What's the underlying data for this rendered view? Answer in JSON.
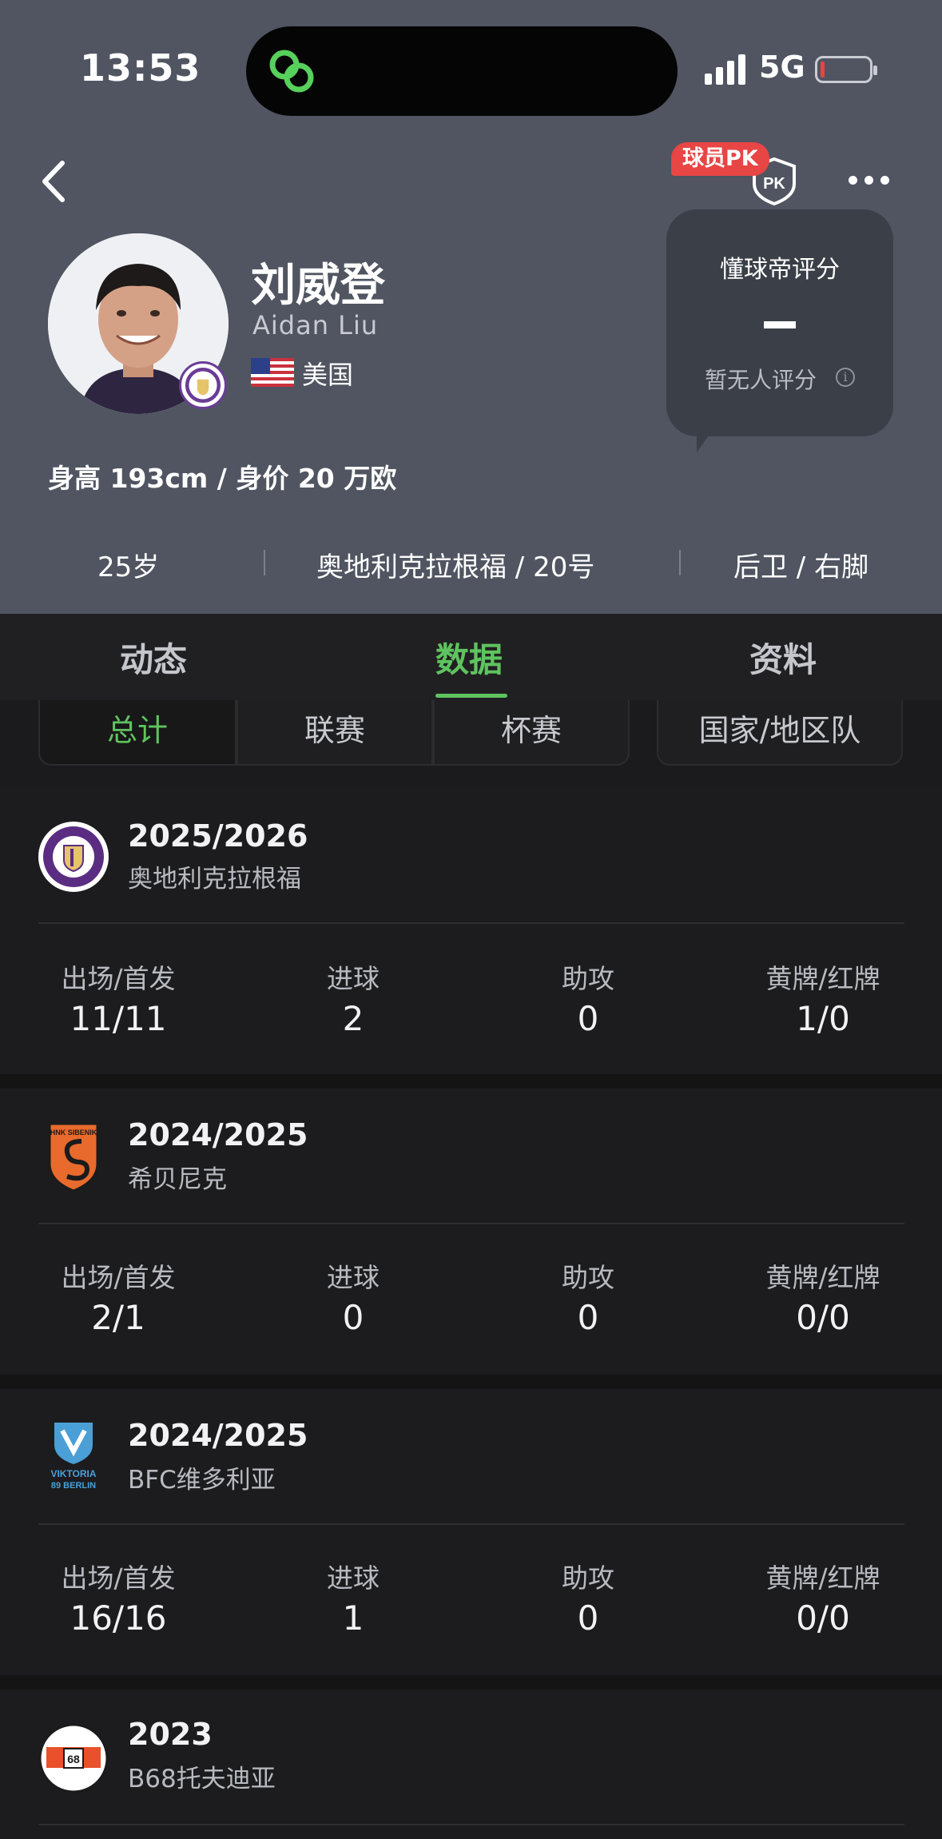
{
  "status_bar": {
    "time": "13:53",
    "network": "5G"
  },
  "nav": {
    "pk_label": "球员PK",
    "pk_shield_text": "PK"
  },
  "player": {
    "name_cn": "刘威登",
    "name_en": "Aidan Liu",
    "nation": "美国",
    "height_value": "身高 193cm / 身价 20 万欧"
  },
  "rating": {
    "title": "懂球帝评分",
    "sub": "暂无人评分",
    "info": "i"
  },
  "facts": {
    "age": "25岁",
    "club_number": "奥地利克拉根福 / 20号",
    "position_foot": "后卫 / 右脚"
  },
  "tabs": [
    "动态",
    "数据",
    "资料"
  ],
  "subtabs": [
    "总计",
    "联赛",
    "杯赛",
    "国家/地区队"
  ],
  "stat_labels": [
    "出场/首发",
    "进球",
    "助攻",
    "黄牌/红牌"
  ],
  "seasons": [
    {
      "season": "2025/2026",
      "team": "奥地利克拉根福",
      "stats": [
        "11/11",
        "2",
        "0",
        "1/0"
      ]
    },
    {
      "season": "2024/2025",
      "team": "希贝尼克",
      "stats": [
        "2/1",
        "0",
        "0",
        "0/0"
      ]
    },
    {
      "season": "2024/2025",
      "team": "BFC维多利亚",
      "stats": [
        "16/16",
        "1",
        "0",
        "0/0"
      ]
    },
    {
      "season": "2023",
      "team": "B68托夫迪亚",
      "stats": []
    }
  ],
  "logos": {
    "austria_ring": "AUSTRIA KLAGENFURT",
    "sibenik": "HNK SIBENIK",
    "viktoria": "VIKTORIA",
    "viktoria_sub": "89 BERLIN",
    "b68": "68"
  },
  "colors": {
    "accent": "#5fc35f",
    "header_bg": "#505561",
    "badge_red": "#e84545"
  }
}
